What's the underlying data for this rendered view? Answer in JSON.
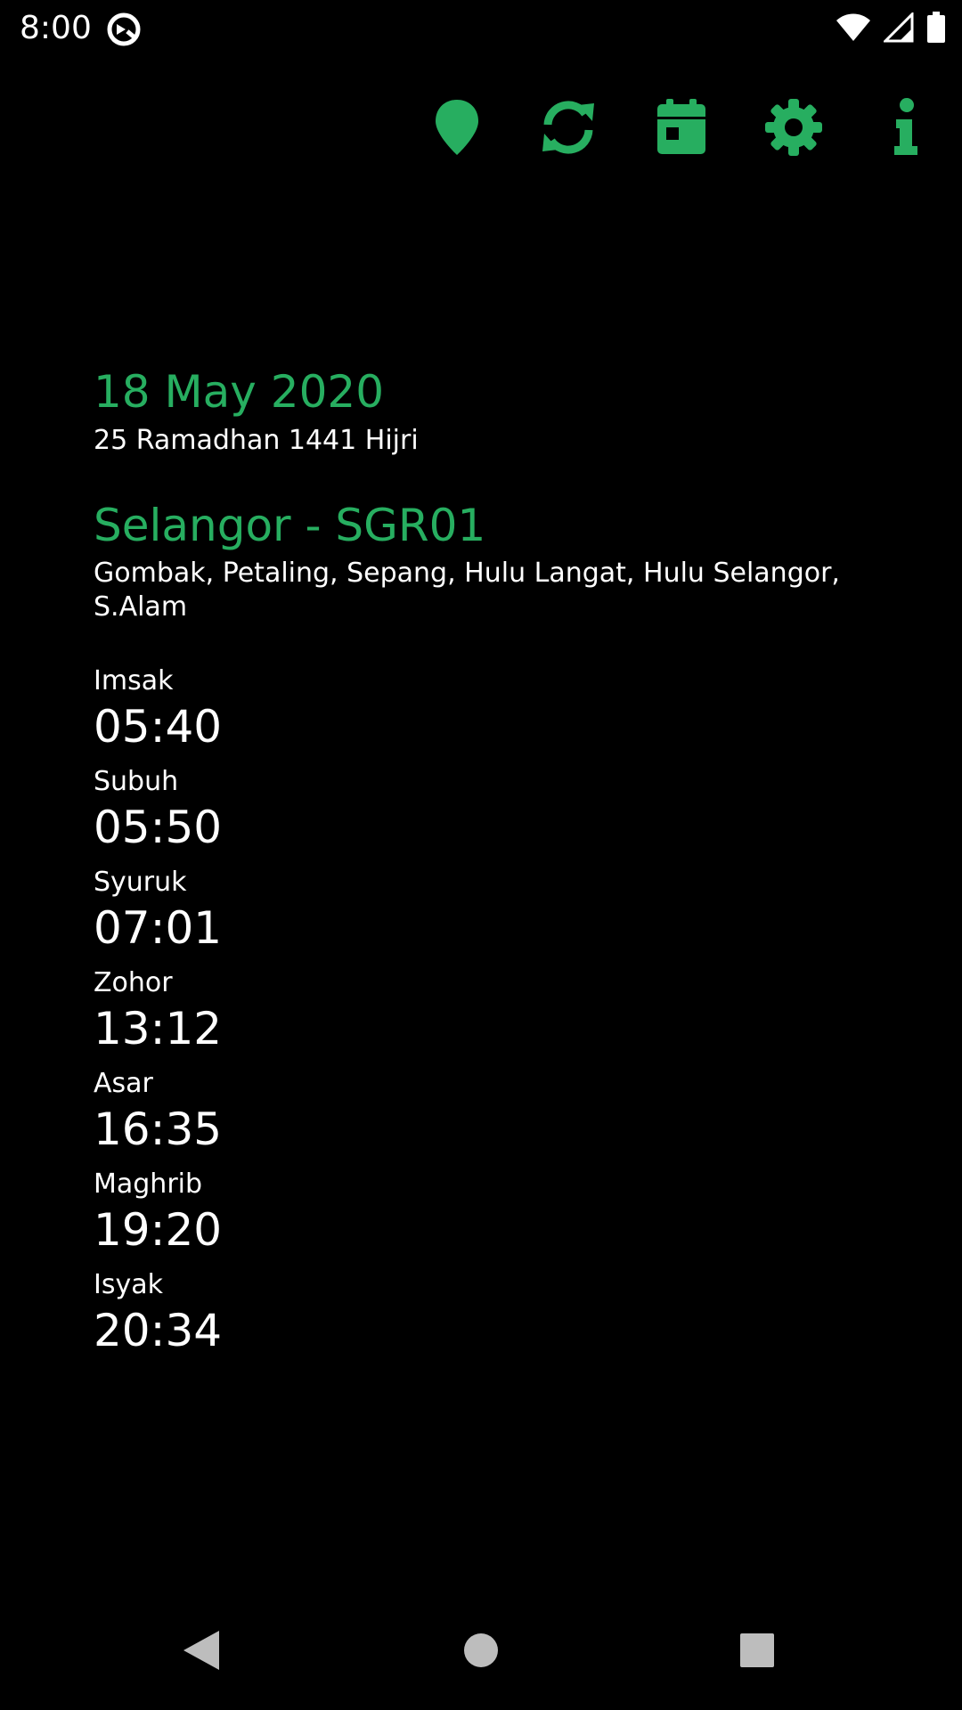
{
  "status_bar": {
    "time": "8:00",
    "icons": [
      "app-notification-icon",
      "wifi-icon",
      "signal-icon",
      "battery-icon"
    ]
  },
  "toolbar": {
    "accent": "#27ae60",
    "buttons": [
      "location-icon",
      "refresh-icon",
      "calendar-icon",
      "settings-icon",
      "info-icon"
    ]
  },
  "main": {
    "gregorian_date": "18 May 2020",
    "hijri_date": "25 Ramadhan 1441 Hijri",
    "zone_title": "Selangor - SGR01",
    "zone_areas": "Gombak, Petaling, Sepang, Hulu Langat, Hulu Selangor, S.Alam",
    "prayers": [
      {
        "name": "Imsak",
        "time": "05:40"
      },
      {
        "name": "Subuh",
        "time": "05:50"
      },
      {
        "name": "Syuruk",
        "time": "07:01"
      },
      {
        "name": "Zohor",
        "time": "13:12"
      },
      {
        "name": "Asar",
        "time": "16:35"
      },
      {
        "name": "Maghrib",
        "time": "19:20"
      },
      {
        "name": "Isyak",
        "time": "20:34"
      }
    ]
  },
  "nav_bar": {
    "buttons": [
      "back-icon",
      "home-icon",
      "recents-icon"
    ]
  }
}
